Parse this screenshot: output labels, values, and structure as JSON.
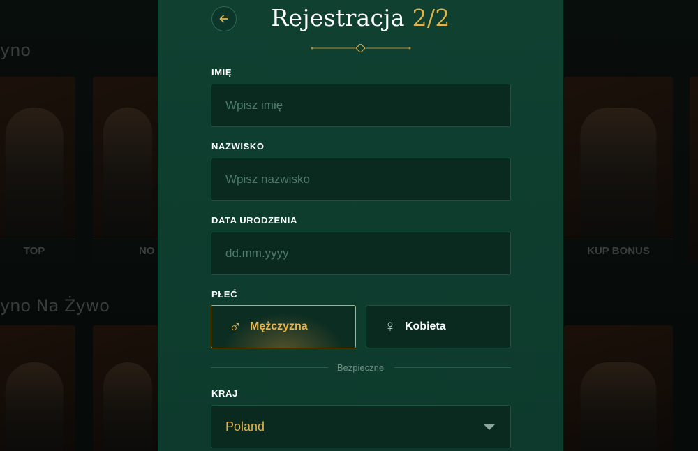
{
  "background": {
    "section1_heading": "yno",
    "section2_heading": "yno Na Żywo",
    "card_labels": [
      "TOP",
      "NO",
      "KUP BONUS"
    ]
  },
  "modal": {
    "title": "Rejestracja",
    "step": "2/2",
    "back_icon": "arrow-left-icon",
    "fields": {
      "first_name": {
        "label": "IMIĘ",
        "placeholder": "Wpisz imię"
      },
      "last_name": {
        "label": "NAZWISKO",
        "placeholder": "Wpisz nazwisko"
      },
      "birth_date": {
        "label": "DATA URODZENIA",
        "placeholder": "dd.mm.yyyy"
      }
    },
    "gender": {
      "label": "PŁEĆ",
      "options": [
        {
          "label": "Mężczyzna",
          "icon": "male-icon",
          "selected": true
        },
        {
          "label": "Kobieta",
          "icon": "female-icon",
          "selected": false
        }
      ]
    },
    "secure_text": "Bezpieczne",
    "country": {
      "label": "KRAJ",
      "value": "Poland"
    }
  },
  "colors": {
    "accent_gold": "#e1b44c",
    "panel_green": "#0f4030",
    "input_bg": "#0a2a20"
  }
}
